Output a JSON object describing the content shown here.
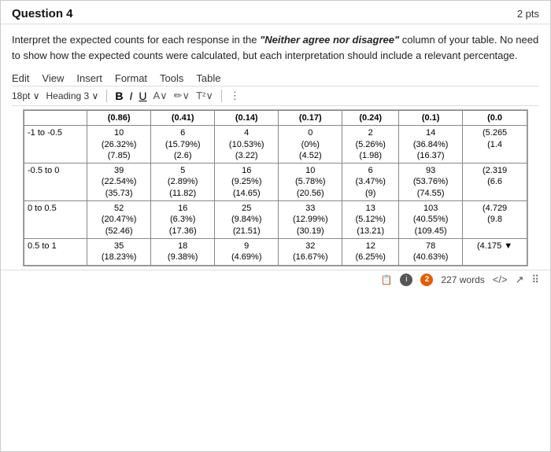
{
  "header": {
    "title": "Question 4",
    "pts": "2 pts"
  },
  "question": {
    "text_parts": [
      "Interpret the expected counts for each response in the ",
      "“Neither agree nor disagree”",
      " column of your table. No need to show how the expected counts were calculated, but each interpretation should include a relevant percentage."
    ]
  },
  "menu": {
    "items": [
      "Edit",
      "View",
      "Insert",
      "Format",
      "Tools",
      "Table"
    ]
  },
  "toolbar": {
    "font_size": "18pt",
    "heading": "Heading 3",
    "bold": "B",
    "italic": "I",
    "underline": "U",
    "more_icon": "⋮"
  },
  "table": {
    "columns": [
      "",
      "(0.86)",
      "(0.41)",
      "(0.14)",
      "(0.17)",
      "(0.24)",
      "(0.1)",
      "(0.0"
    ],
    "rows": [
      {
        "label": "-1 to -0.5",
        "cells": [
          "10\n(26.32%)\n(7.85)",
          "6\n(15.79%)\n(2.6)",
          "4\n(10.53%)\n(3.22)",
          "0\n(0%)\n(4.52)",
          "2\n(5.26%)\n(1.98)",
          "14\n(36.84%)\n(16.37)",
          "(5.265\n(1.4"
        ]
      },
      {
        "label": "-0.5 to 0",
        "cells": [
          "39\n(22.54%)\n(35.73)",
          "5\n(2.89%)\n(11.82)",
          "16\n(9.25%)\n(14.65)",
          "10\n(5.78%)\n(20.56)",
          "6\n(3.47%)\n(9)",
          "93\n(53.76%)\n(74.55)",
          "(2.319\n(6.6"
        ]
      },
      {
        "label": "0 to 0.5",
        "cells": [
          "52\n(20.47%)\n(52.46)",
          "16\n(6.3%)\n(17.36)",
          "25\n(9.84%)\n(21.51)",
          "33\n(12.99%)\n(30.19)",
          "13\n(5.12%)\n(13.21)",
          "103\n(40.55%)\n(109.45)",
          "(4.729\n(9.8"
        ]
      },
      {
        "label": "0.5 to 1",
        "cells": [
          "35\n(18.23%)",
          "18\n(9.38%)",
          "9\n(4.69%)",
          "32\n(16.67%)",
          "12\n(6.25%)",
          "78\n(40.63%)",
          "(4.175"
        ]
      }
    ]
  },
  "footer": {
    "word_count_label": "227 words",
    "badge_count": "2",
    "code_icon": "</>",
    "expand_icon": "↗",
    "drag_icon": "⋮⋮"
  }
}
